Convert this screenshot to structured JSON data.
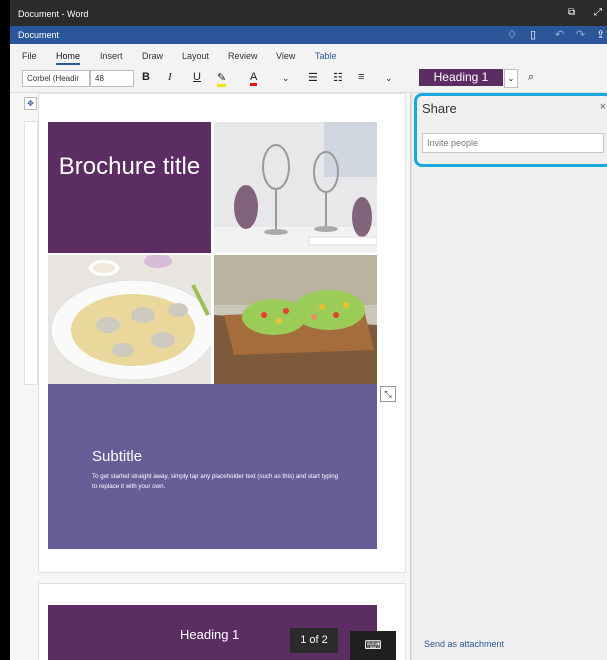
{
  "window": {
    "title": "Document - Word"
  },
  "docbar": {
    "title": "Document",
    "icons": [
      "lightbulb-icon",
      "layout-icon",
      "undo-icon",
      "redo-icon",
      "share-icon"
    ]
  },
  "menu": {
    "file": "File",
    "home": "Home",
    "insert": "Insert",
    "draw": "Draw",
    "layout": "Layout",
    "review": "Review",
    "view": "View",
    "table": "Table"
  },
  "toolbar": {
    "font": "Corbel (Headir",
    "size": "48",
    "bold": "B",
    "italic": "I",
    "underline": "U",
    "font_color": "A",
    "style": "Heading 1"
  },
  "document": {
    "brochure_title": "Brochure title",
    "subtitle": "Subtitle",
    "body": "To get started straight away, simply tap any placeholder text (such as this) and start typing to replace it with your own.",
    "heading": "Heading 1",
    "page_count": "1 of 2"
  },
  "share": {
    "heading": "Share",
    "close": "×",
    "invite_placeholder": "Invite people",
    "send_attachment": "Send as attachment"
  },
  "colors": {
    "accent": "#2b579a",
    "purple": "#5c2d63",
    "subtitle_bg": "#695d98",
    "focus": "#1aa7e0"
  }
}
